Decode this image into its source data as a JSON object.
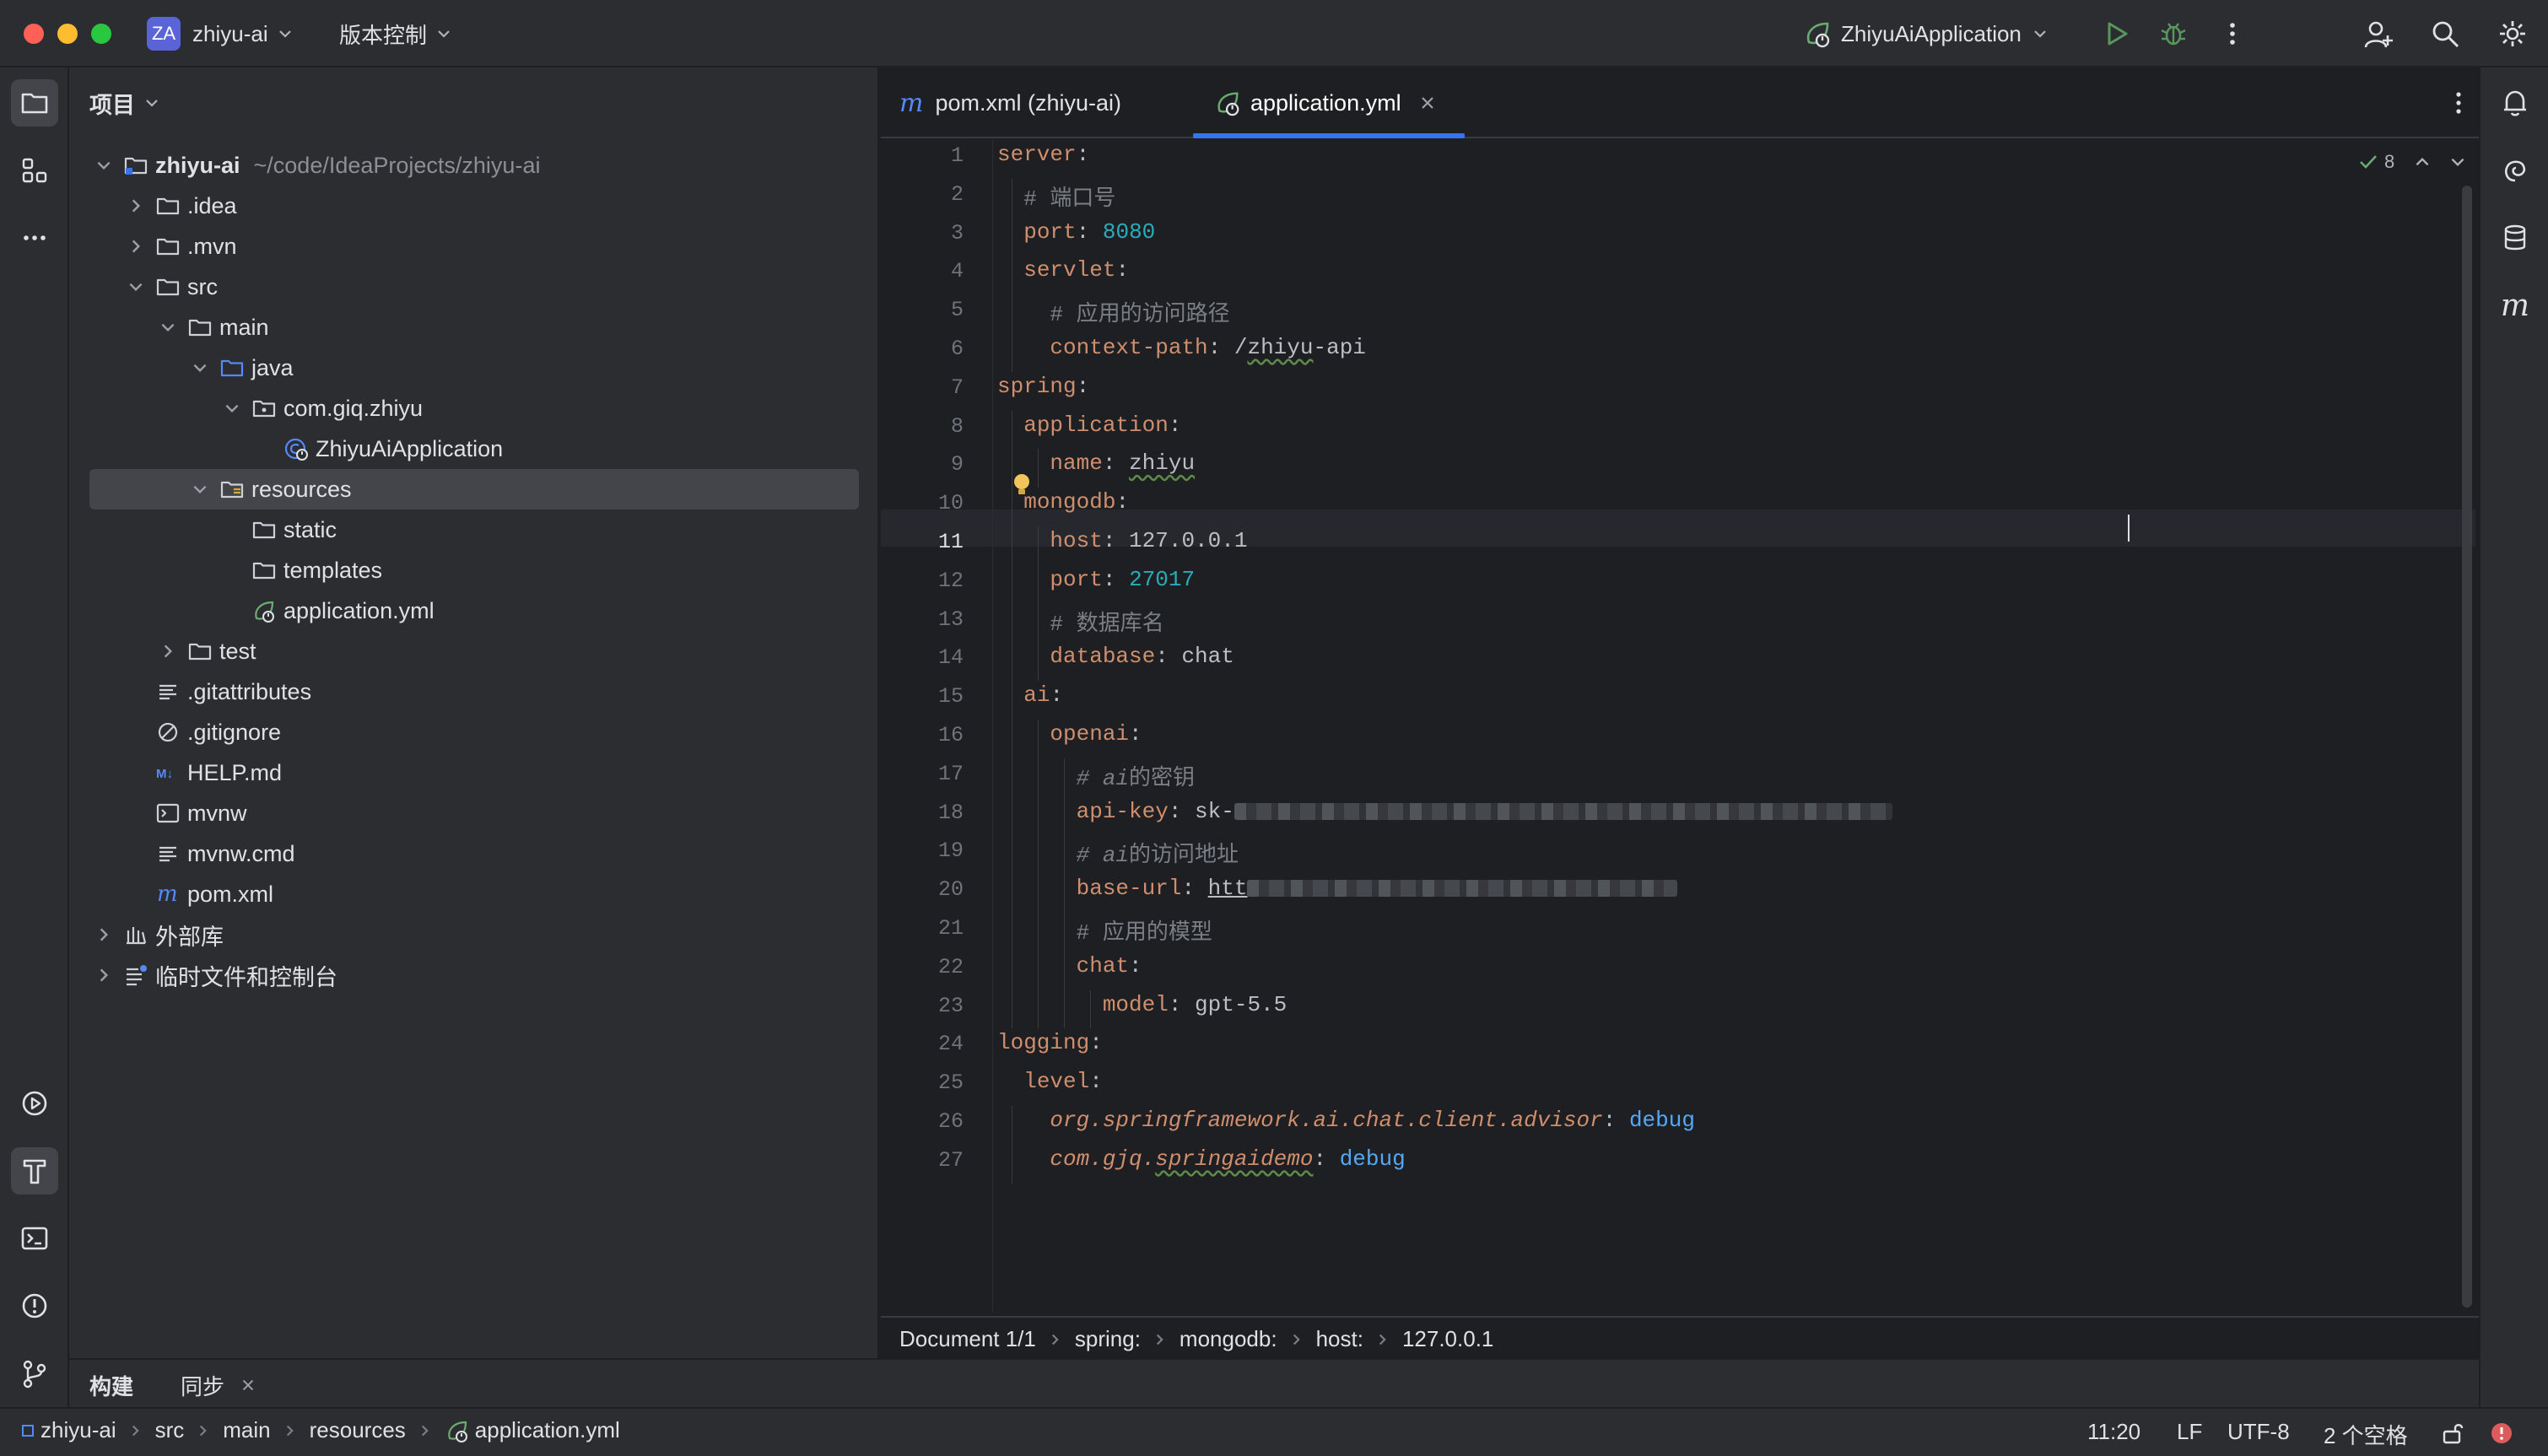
{
  "titlebar": {
    "project_badge": "ZA",
    "project_name": "zhiyu-ai",
    "vcs_menu": "版本控制",
    "run_config": "ZhiyuAiApplication"
  },
  "project_panel": {
    "title": "项目",
    "tree": [
      {
        "label": "zhiyu-ai",
        "path": "~/code/IdeaProjects/zhiyu-ai",
        "depth": 0,
        "expanded": true,
        "icon": "module-folder-icon"
      },
      {
        "label": ".idea",
        "depth": 1,
        "expanded": false,
        "icon": "folder-icon"
      },
      {
        "label": ".mvn",
        "depth": 1,
        "expanded": false,
        "icon": "folder-icon"
      },
      {
        "label": "src",
        "depth": 1,
        "expanded": true,
        "icon": "folder-icon"
      },
      {
        "label": "main",
        "depth": 2,
        "expanded": true,
        "icon": "folder-icon"
      },
      {
        "label": "java",
        "depth": 3,
        "expanded": true,
        "icon": "source-folder-icon"
      },
      {
        "label": "com.giq.zhiyu",
        "depth": 4,
        "expanded": true,
        "icon": "package-icon"
      },
      {
        "label": "ZhiyuAiApplication",
        "depth": 5,
        "icon": "spring-boot-class-icon"
      },
      {
        "label": "resources",
        "depth": 3,
        "expanded": true,
        "icon": "resources-folder-icon",
        "selected": true
      },
      {
        "label": "static",
        "depth": 4,
        "icon": "folder-icon"
      },
      {
        "label": "templates",
        "depth": 4,
        "icon": "folder-icon"
      },
      {
        "label": "application.yml",
        "depth": 4,
        "icon": "spring-yaml-icon"
      },
      {
        "label": "test",
        "depth": 2,
        "expanded": false,
        "icon": "folder-icon"
      },
      {
        "label": ".gitattributes",
        "depth": 1,
        "icon": "text-file-icon"
      },
      {
        "label": ".gitignore",
        "depth": 1,
        "icon": "ignore-file-icon"
      },
      {
        "label": "HELP.md",
        "depth": 1,
        "icon": "markdown-icon"
      },
      {
        "label": "mvnw",
        "depth": 1,
        "icon": "shell-script-icon"
      },
      {
        "label": "mvnw.cmd",
        "depth": 1,
        "icon": "text-file-icon"
      },
      {
        "label": "pom.xml",
        "depth": 1,
        "icon": "maven-icon"
      },
      {
        "label": "外部库",
        "depth": 0,
        "expanded": false,
        "icon": "library-icon"
      },
      {
        "label": "临时文件和控制台",
        "depth": 0,
        "expanded": false,
        "icon": "scratches-icon"
      }
    ]
  },
  "editor": {
    "tabs": [
      {
        "label": "pom.xml (zhiyu-ai)",
        "active": false
      },
      {
        "label": "application.yml",
        "active": true
      }
    ],
    "inspection_count": "8",
    "current_line": 11,
    "lines": [
      [
        [
          "k",
          "server"
        ],
        [
          "p",
          ":"
        ]
      ],
      [
        [
          "p",
          "  "
        ],
        [
          "c",
          "# 端口号"
        ]
      ],
      [
        [
          "p",
          "  "
        ],
        [
          "k",
          "port"
        ],
        [
          "p",
          ": "
        ],
        [
          "n",
          "8080"
        ]
      ],
      [
        [
          "p",
          "  "
        ],
        [
          "k",
          "servlet"
        ],
        [
          "p",
          ":"
        ]
      ],
      [
        [
          "p",
          "    "
        ],
        [
          "c",
          "# 应用的访问路径"
        ]
      ],
      [
        [
          "p",
          "    "
        ],
        [
          "k",
          "context-path"
        ],
        [
          "p",
          ": /"
        ],
        [
          "sq",
          "zhiyu"
        ],
        [
          "p",
          "-api"
        ]
      ],
      [
        [
          "k",
          "spring"
        ],
        [
          "p",
          ":"
        ]
      ],
      [
        [
          "p",
          "  "
        ],
        [
          "k",
          "application"
        ],
        [
          "p",
          ":"
        ]
      ],
      [
        [
          "p",
          "    "
        ],
        [
          "k",
          "name"
        ],
        [
          "p",
          ": "
        ],
        [
          "sq",
          "zhiyu"
        ]
      ],
      [
        [
          "p",
          "  "
        ],
        [
          "k",
          "mongodb"
        ],
        [
          "p",
          ":"
        ]
      ],
      [
        [
          "p",
          "    "
        ],
        [
          "k",
          "host"
        ],
        [
          "p",
          ": 127.0.0.1"
        ]
      ],
      [
        [
          "p",
          "    "
        ],
        [
          "k",
          "port"
        ],
        [
          "p",
          ": "
        ],
        [
          "n",
          "27017"
        ]
      ],
      [
        [
          "p",
          "    "
        ],
        [
          "c",
          "# 数据库名"
        ]
      ],
      [
        [
          "p",
          "    "
        ],
        [
          "k",
          "database"
        ],
        [
          "p",
          ": chat"
        ]
      ],
      [
        [
          "p",
          "  "
        ],
        [
          "k",
          "ai"
        ],
        [
          "p",
          ":"
        ]
      ],
      [
        [
          "p",
          "    "
        ],
        [
          "k",
          "openai"
        ],
        [
          "p",
          ":"
        ]
      ],
      [
        [
          "p",
          "      "
        ],
        [
          "ci",
          "# ai"
        ],
        [
          "c",
          "的密钥"
        ]
      ],
      [
        [
          "p",
          "      "
        ],
        [
          "k",
          "api-key"
        ],
        [
          "p",
          ": sk-"
        ],
        [
          "blur",
          "780"
        ]
      ],
      [
        [
          "p",
          "      "
        ],
        [
          "ci",
          "# ai"
        ],
        [
          "c",
          "的访问地址"
        ]
      ],
      [
        [
          "p",
          "      "
        ],
        [
          "k",
          "base-url"
        ],
        [
          "p",
          ": "
        ],
        [
          "u",
          "htt"
        ],
        [
          "blur",
          "510"
        ]
      ],
      [
        [
          "p",
          "      "
        ],
        [
          "c",
          "# 应用的模型"
        ]
      ],
      [
        [
          "p",
          "      "
        ],
        [
          "k",
          "chat"
        ],
        [
          "p",
          ":"
        ]
      ],
      [
        [
          "p",
          "        "
        ],
        [
          "k",
          "model"
        ],
        [
          "p",
          ": gpt-5.5"
        ]
      ],
      [
        [
          "k",
          "logging"
        ],
        [
          "p",
          ":"
        ]
      ],
      [
        [
          "p",
          "  "
        ],
        [
          "k",
          "level"
        ],
        [
          "p",
          ":"
        ]
      ],
      [
        [
          "p",
          "    "
        ],
        [
          "ki",
          "org.springframework.ai.chat.client.advisor"
        ],
        [
          "p",
          ": "
        ],
        [
          "b",
          "debug"
        ]
      ],
      [
        [
          "p",
          "    "
        ],
        [
          "ki",
          "com.gjq."
        ],
        [
          "kisq",
          "springaidemo"
        ],
        [
          "p",
          ": "
        ],
        [
          "b",
          "debug"
        ]
      ]
    ],
    "breadcrumbs": [
      "Document 1/1",
      "spring:",
      "mongodb:",
      "host:",
      "127.0.0.1"
    ]
  },
  "bottom_tools": {
    "build_tab": "构建",
    "sync_tab": "同步"
  },
  "statusbar": {
    "path": [
      "zhiyu-ai",
      "src",
      "main",
      "resources",
      "application.yml"
    ],
    "caret": "11:20",
    "line_sep": "LF",
    "encoding": "UTF-8",
    "indent": "2 个空格"
  },
  "colors": {
    "accent": "#3574f0",
    "run_green": "#57965c",
    "error_red": "#db5c5c",
    "yaml_key": "#cf8e6d",
    "number": "#2aacb8",
    "comment": "#7a7e85"
  }
}
